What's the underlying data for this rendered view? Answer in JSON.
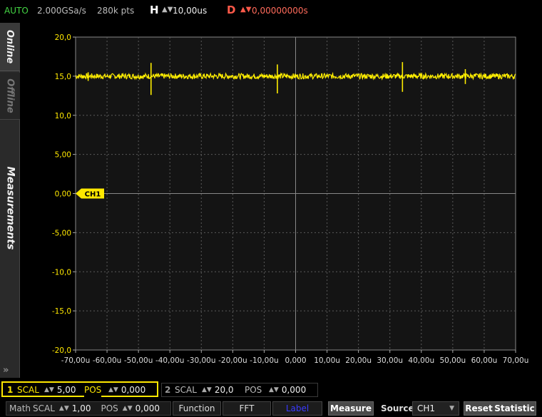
{
  "header": {
    "mode": "AUTO",
    "sample_rate": "2.000GSa/s",
    "points": "280k pts",
    "h_label": "H",
    "h_value": "10,00us",
    "d_label": "D",
    "d_value": "0,00000000s",
    "spin_glyph": "▲▼"
  },
  "sidebar": {
    "tabs": [
      {
        "label": "Online"
      },
      {
        "label": "Offline"
      },
      {
        "label": "Measurements"
      }
    ],
    "collapse_glyph": "»"
  },
  "channel_marker": "CH1",
  "colors": {
    "trace": "#ffee00",
    "grid": "#5a5a5a",
    "ch1": "#ffe800",
    "delay": "#ff5a4a",
    "auto": "#44d644"
  },
  "chart_data": {
    "type": "line",
    "x_ticks": [
      "-70,00u",
      "-60,00u",
      "-50,00u",
      "-40,00u",
      "-30,00u",
      "-20,00u",
      "-10,00u",
      "0,000",
      "10,00u",
      "20,00u",
      "30,00u",
      "40,00u",
      "50,00u",
      "60,00u",
      "70,00u"
    ],
    "y_ticks": [
      "20,0",
      "15,0",
      "10,0",
      "5,00",
      "0,00",
      "-5,00",
      "-10,0",
      "-15,0",
      "-20,0"
    ],
    "xlim": [
      -70,
      70
    ],
    "ylim": [
      -20,
      20
    ],
    "grid": true,
    "series": [
      {
        "baseline": 15.0,
        "noise": 0.35,
        "spikes": [
          {
            "x": -46.0,
            "high": 16.7,
            "low": 12.6
          },
          {
            "x": -5.8,
            "high": 16.5,
            "low": 12.8
          },
          {
            "x": 34.0,
            "high": 16.8,
            "low": 13.0
          },
          {
            "x": 54.0,
            "high": 15.9,
            "low": 14.0
          },
          {
            "x": -66.0,
            "high": 15.5,
            "low": 14.4
          }
        ]
      }
    ]
  },
  "controls": {
    "ch1": {
      "num": "1",
      "scal_label": "SCAL",
      "scal_value": "5,00",
      "pos_label": "POS",
      "pos_value": "0,000"
    },
    "ch2": {
      "num": "2",
      "scal_label": "SCAL",
      "scal_value": "20,0",
      "pos_label": "POS",
      "pos_value": "0,000"
    },
    "math": {
      "label": "Math",
      "scal_label": "SCAL",
      "scal_value": "1,00",
      "pos_label": "POS",
      "pos_value": "0,000"
    },
    "function_label": "Function",
    "fft_label": "FFT",
    "label_label": "Label",
    "measure_label": "Measure",
    "source_label": "Source",
    "source_value": "CH1",
    "reset_label": "Reset",
    "statistic_label": "Statistic"
  }
}
